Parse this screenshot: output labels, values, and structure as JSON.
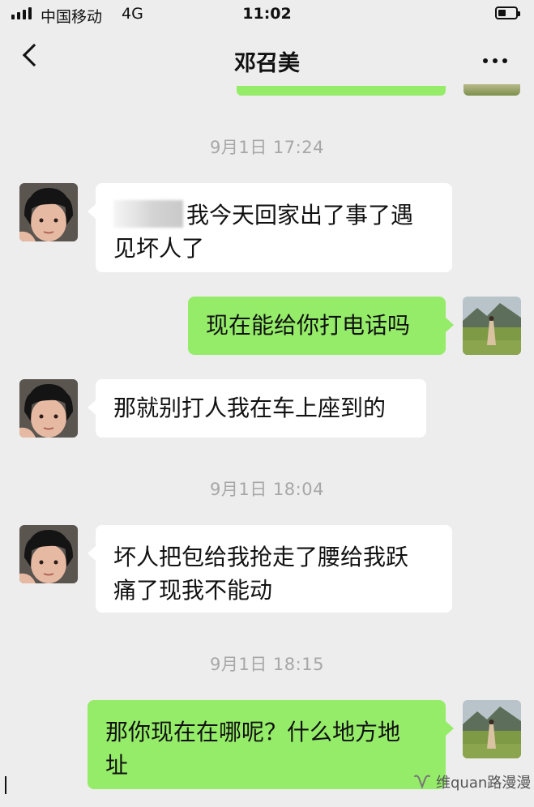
{
  "status_bar": {
    "carrier": "中国移动",
    "network": "4G",
    "time": "11:02",
    "battery_level": 0.45
  },
  "header": {
    "title": "邓召美",
    "back_icon": "chevron-left-icon",
    "more_icon": "more-dots-icon"
  },
  "messages": [
    {
      "type": "time",
      "text": "9月1日 17:24"
    },
    {
      "type": "in",
      "text": "我今天回家出了事了遇见坏人了",
      "line1": "我今天回家出了事了遇",
      "line2": "见坏人了",
      "redacted_prefix": true
    },
    {
      "type": "out",
      "text": "现在能给你打电话吗"
    },
    {
      "type": "in",
      "text": "那就别打人我在车上座到的"
    },
    {
      "type": "time",
      "text": "9月1日 18:04"
    },
    {
      "type": "in",
      "text": "坏人把包给我抢走了腰给我跃痛了现我不能动",
      "line1": "坏人把包给我抢走了腰给我跃",
      "line2": "痛了现我不能动"
    },
    {
      "type": "time",
      "text": "9月1日 18:15"
    },
    {
      "type": "out",
      "text": "那你现在在哪呢？什么地方地址",
      "line1": "那你现在在哪呢？什么地方地",
      "line2": "址"
    }
  ],
  "watermark": {
    "icon": "wechat-channel-icon",
    "text": "维quan路漫漫"
  },
  "colors": {
    "background": "#ededed",
    "incoming_bubble": "#ffffff",
    "outgoing_bubble": "#95ec69",
    "timestamp": "#a7a7a7"
  }
}
